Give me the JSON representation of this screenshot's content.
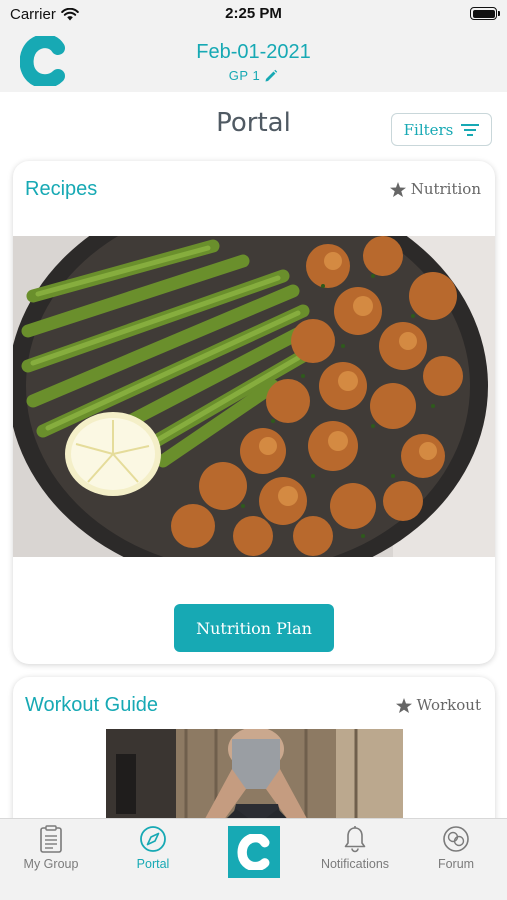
{
  "status_bar": {
    "carrier": "Carrier",
    "time": "2:25 PM"
  },
  "header": {
    "date": "Feb-01-2021",
    "group": "GP 1"
  },
  "page": {
    "title": "Portal",
    "filters_label": "Filters"
  },
  "cards": [
    {
      "title": "Recipes",
      "tag": "Nutrition",
      "button_label": "Nutrition Plan"
    },
    {
      "title": "Workout Guide",
      "tag": "Workout"
    }
  ],
  "tabs": [
    {
      "label": "My Group",
      "icon": "clipboard-icon",
      "active": false
    },
    {
      "label": "Portal",
      "icon": "compass-icon",
      "active": true
    },
    {
      "label": "",
      "icon": "app-logo-icon",
      "active": false
    },
    {
      "label": "Notifications",
      "icon": "bell-icon",
      "active": false
    },
    {
      "label": "Forum",
      "icon": "chat-bubbles-icon",
      "active": false
    }
  ],
  "colors": {
    "accent": "#17a9b4",
    "header_bg": "#f2f2f2",
    "muted_text": "#7b7b7b"
  }
}
